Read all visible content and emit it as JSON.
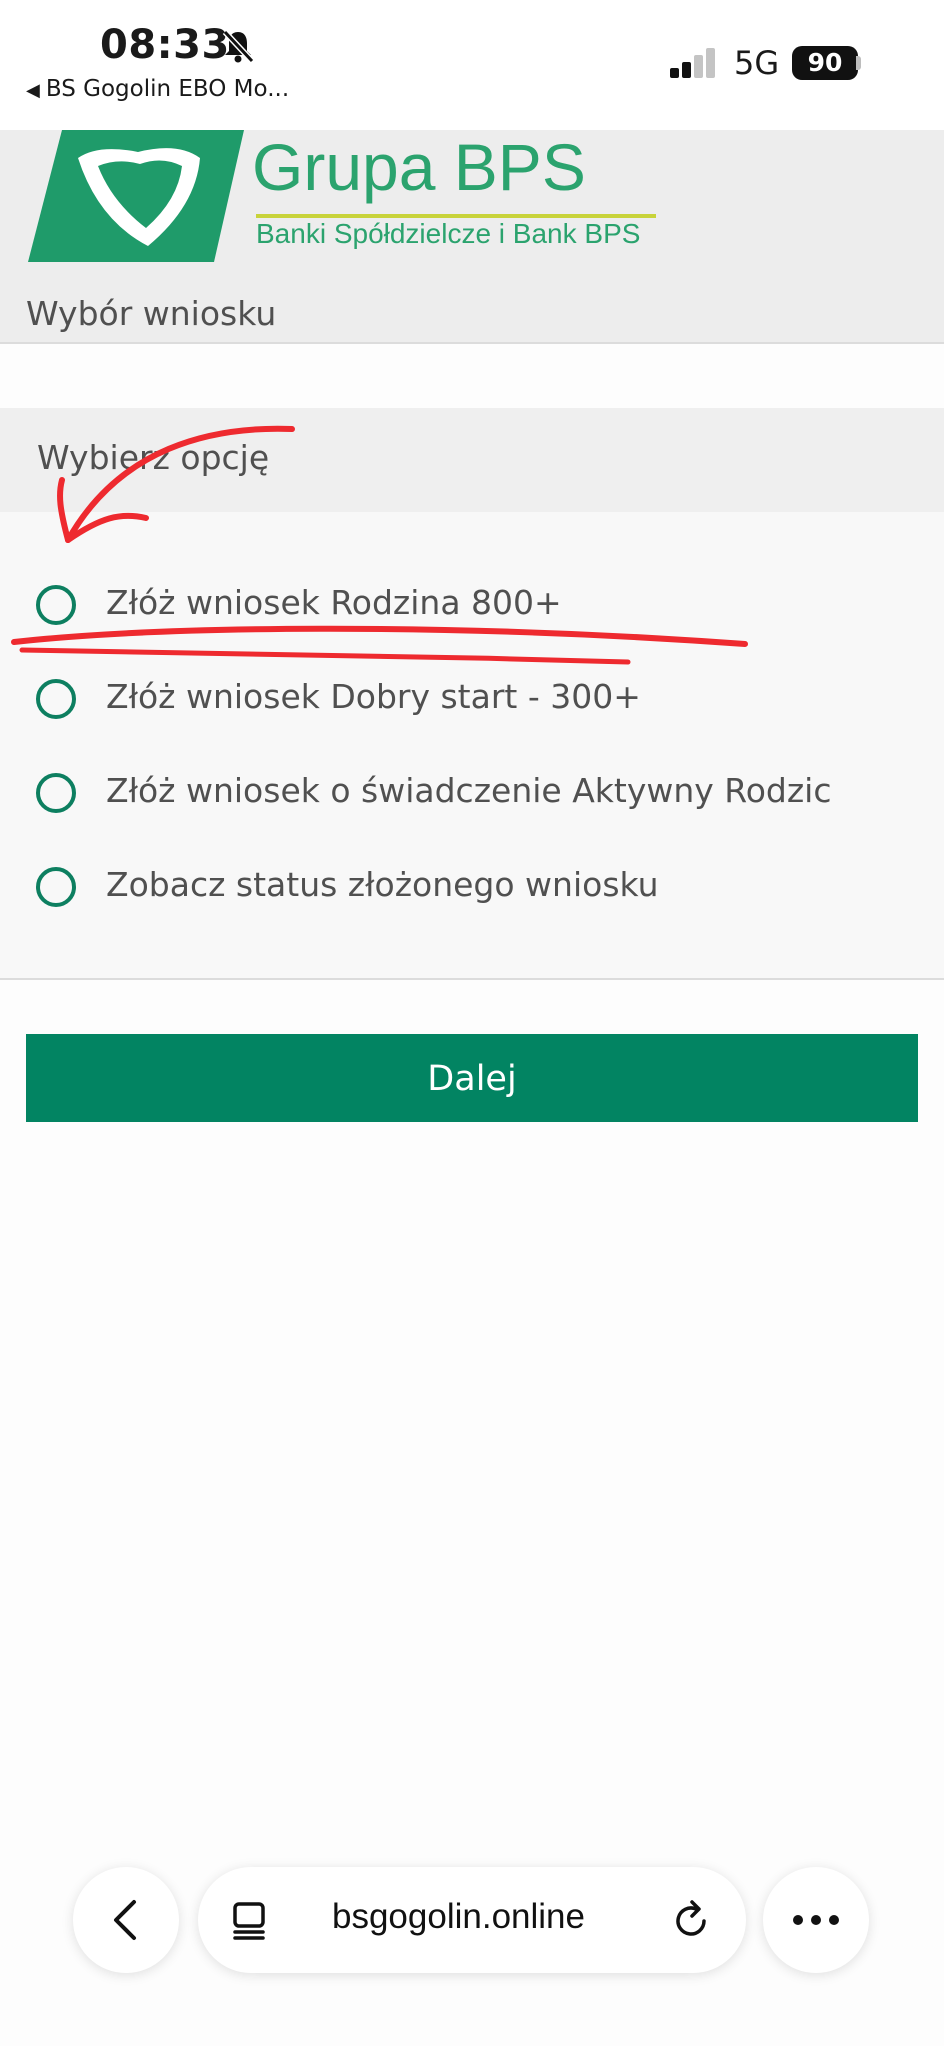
{
  "status_bar": {
    "time": "08:33",
    "back_app_label": "BS Gogolin EBO Mo...",
    "network": "5G",
    "battery_level": "90"
  },
  "header": {
    "brand_name": "Grupa BPS",
    "brand_subtitle": "Banki Spółdzielcze i Bank BPS",
    "section_title": "Wybór wniosku"
  },
  "form": {
    "prompt": "Wybierz opcję",
    "options": [
      {
        "label": "Złóż wniosek Rodzina 800+",
        "selected": false
      },
      {
        "label": "Złóż wniosek Dobry start - 300+",
        "selected": false
      },
      {
        "label": "Złóż wniosek o świadczenie Aktywny Rodzic",
        "selected": false
      },
      {
        "label": "Zobacz status złożonego wniosku",
        "selected": false
      }
    ],
    "next_label": "Dalej"
  },
  "browser": {
    "url": "bsgogolin.online"
  },
  "colors": {
    "brand_green": "#2ba36e",
    "radio_green": "#0d7f60",
    "button_green": "#028462",
    "annotation_red": "#ee2a2f"
  },
  "icons": [
    "bell-slash-icon",
    "cellular-signal-icon",
    "battery-icon",
    "back-chevron-icon",
    "tabs-icon",
    "reload-icon",
    "more-icon"
  ]
}
